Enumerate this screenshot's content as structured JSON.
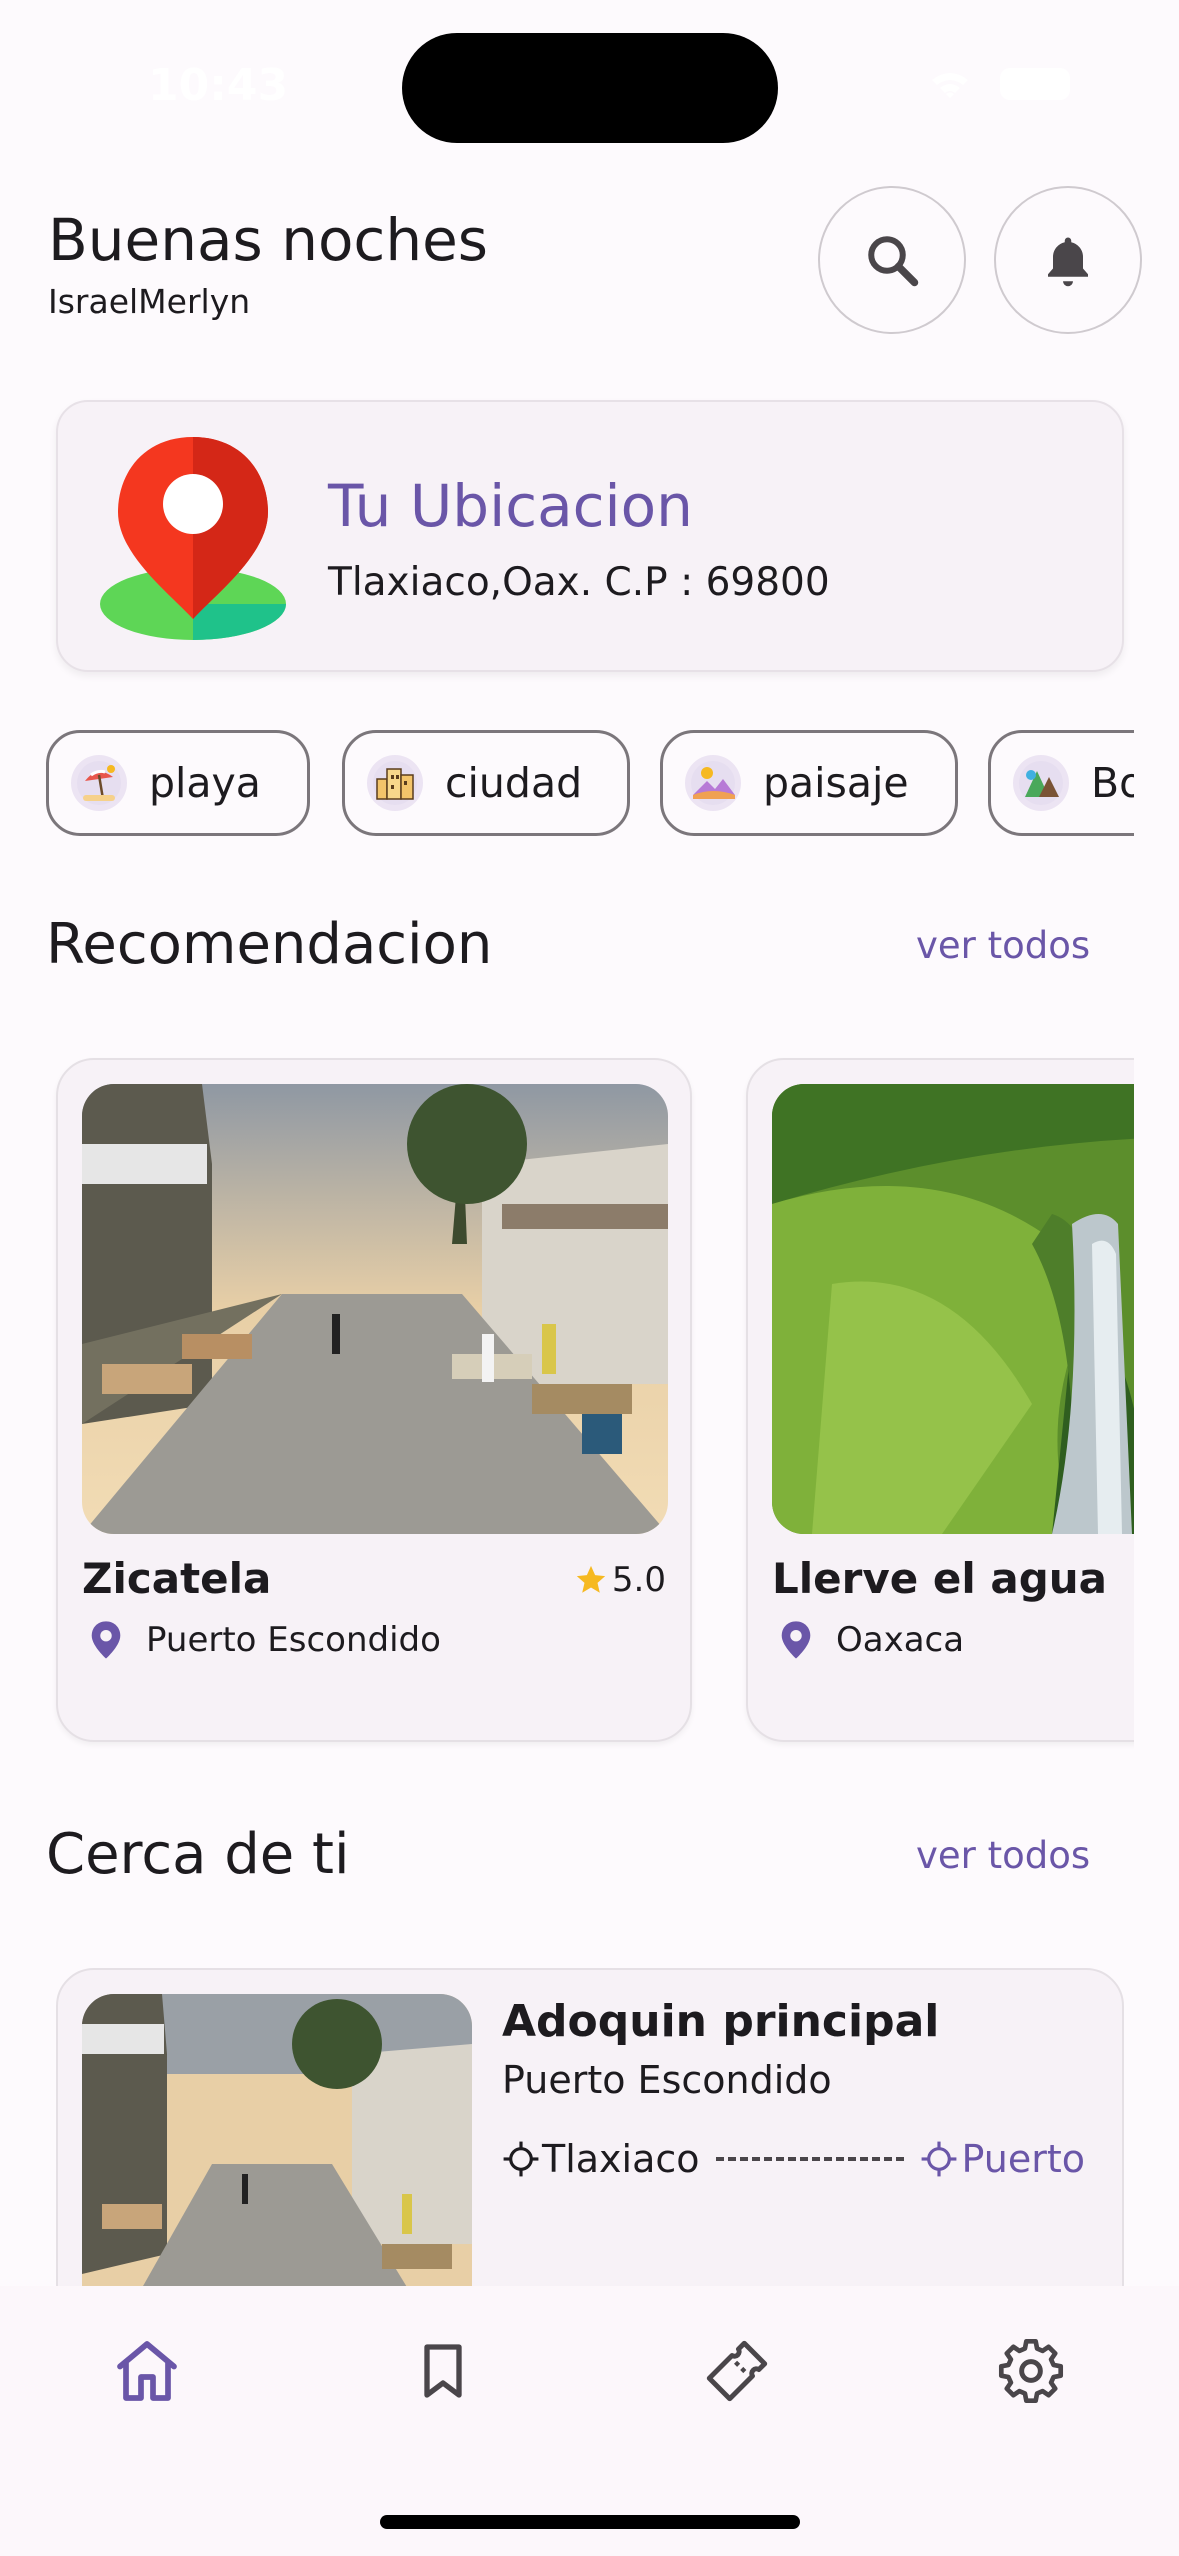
{
  "status": {
    "time": "10:43"
  },
  "header": {
    "greeting": "Buenas noches",
    "username": "IsraelMerlyn"
  },
  "location": {
    "title": "Tu Ubicacion",
    "address": "Tlaxiaco,Oax. C.P : 69800"
  },
  "categories": [
    {
      "label": "playa"
    },
    {
      "label": "ciudad"
    },
    {
      "label": "paisaje"
    },
    {
      "label": "Bosque"
    }
  ],
  "recommendations": {
    "title": "Recomendacion",
    "link": "ver todos",
    "items": [
      {
        "name": "Zicatela",
        "rating": "5.0",
        "location": "Puerto Escondido"
      },
      {
        "name": "Llerve el agua",
        "location": "Oaxaca"
      }
    ]
  },
  "nearby": {
    "title": "Cerca de ti",
    "link": "ver todos",
    "items": [
      {
        "name": "Adoquin principal",
        "city": "Puerto Escondido",
        "from": "Tlaxiaco",
        "to": "Puerto"
      }
    ]
  },
  "colors": {
    "accent": "#6a56a8",
    "star": "#f6b921",
    "pin": "#e8321e"
  }
}
